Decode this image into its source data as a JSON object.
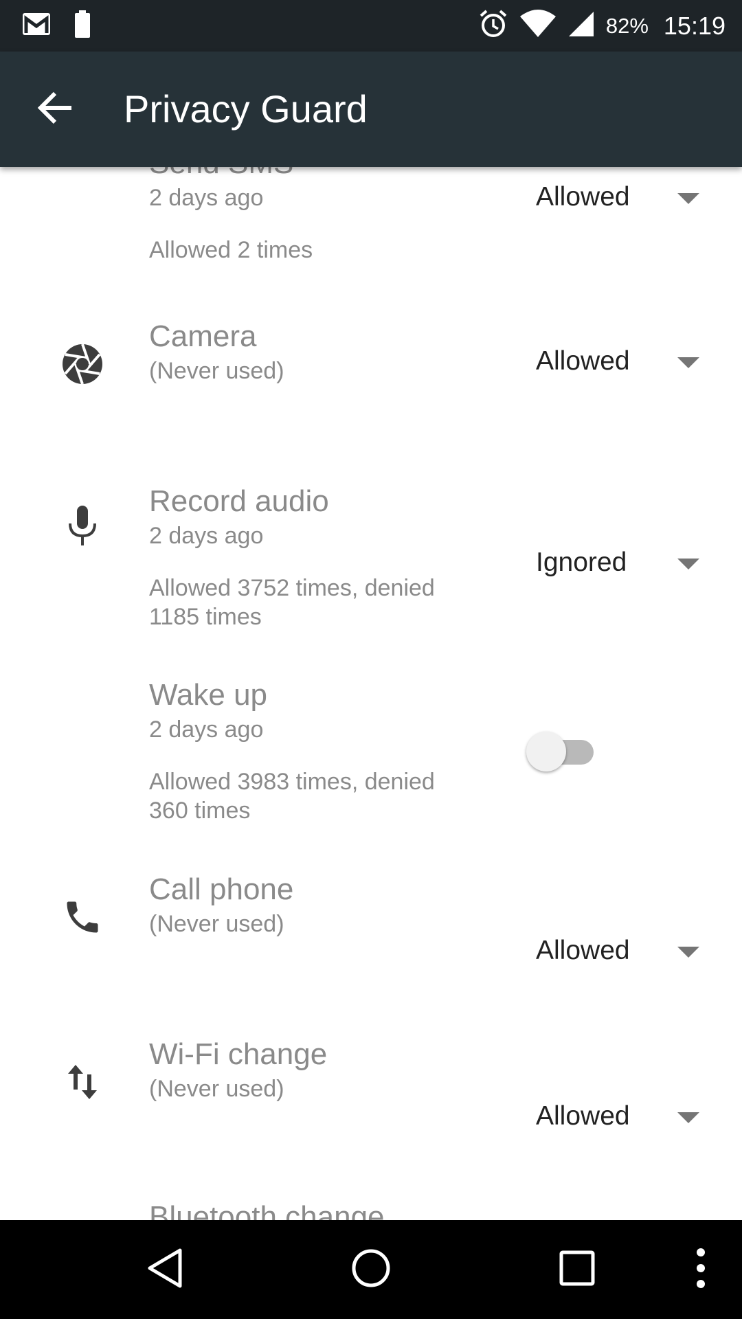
{
  "status_bar": {
    "battery_percent": "82%",
    "time": "15:19",
    "icons": [
      "gmail-icon",
      "battery-notification-icon",
      "alarm-icon",
      "wifi-icon",
      "cell-signal-icon"
    ]
  },
  "toolbar": {
    "title": "Privacy Guard",
    "back_icon": "arrow-back-icon"
  },
  "permissions": [
    {
      "title": "Send SMS",
      "last_used": "2 days ago",
      "count": "Allowed 2 times",
      "control": "spinner",
      "value": "Allowed",
      "icon": ""
    },
    {
      "title": "Camera",
      "last_used": "(Never used)",
      "count": "",
      "control": "spinner",
      "value": "Allowed",
      "icon": "camera-shutter-icon"
    },
    {
      "title": "Record audio",
      "last_used": "2 days ago",
      "count": "Allowed 3752 times, denied 1185 times",
      "control": "spinner",
      "value": "Ignored",
      "icon": "microphone-icon"
    },
    {
      "title": "Wake up",
      "last_used": "2 days ago",
      "count": "Allowed 3983 times, denied 360 times",
      "control": "switch",
      "switch_on": false,
      "icon": ""
    },
    {
      "title": "Call phone",
      "last_used": "(Never used)",
      "count": "",
      "control": "spinner",
      "value": "Allowed",
      "icon": "phone-icon"
    },
    {
      "title": "Wi-Fi change",
      "last_used": "(Never used)",
      "count": "",
      "control": "spinner",
      "value": "Allowed",
      "icon": "swap-vertical-icon"
    },
    {
      "title": "Bluetooth change",
      "last_used": "",
      "count": "",
      "control": "",
      "icon": ""
    }
  ],
  "nav_bar": {
    "buttons": [
      "back-triangle-icon",
      "home-circle-icon",
      "recents-square-icon",
      "overflow-menu-icon"
    ]
  },
  "colors": {
    "status_bar": "#1e2428",
    "toolbar": "#263238",
    "text_secondary": "#8a8a8a",
    "spinner_text": "#222222",
    "nav_bar": "#000000"
  }
}
